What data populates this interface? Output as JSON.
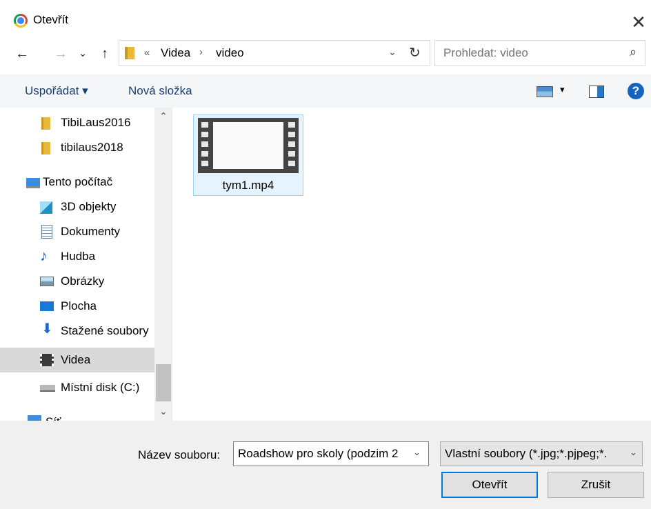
{
  "window": {
    "title": "Otevřít",
    "close_symbol": "✕"
  },
  "nav": {
    "back": "←",
    "forward": "→",
    "recent": "⌄",
    "up": "↑"
  },
  "address": {
    "separator": "«",
    "crumbs": [
      "Videa",
      "video"
    ],
    "arrow": "›",
    "dropdown": "⌄",
    "refresh": "↻"
  },
  "search": {
    "placeholder": "Prohledat: video",
    "icon": "⌕"
  },
  "toolbar": {
    "organize": "Uspořádat ▾",
    "new_folder": "Nová složka",
    "view_dropdown": "▾",
    "help": "?"
  },
  "sidebar": {
    "items": [
      {
        "label": "TibiLaus2016",
        "icon": "folder-icon"
      },
      {
        "label": "tibilaus2018",
        "icon": "folder-icon"
      },
      {
        "label": "Tento počítač",
        "icon": "computer-icon"
      },
      {
        "label": "3D objekty",
        "icon": "cube-icon"
      },
      {
        "label": "Dokumenty",
        "icon": "document-icon"
      },
      {
        "label": "Hudba",
        "icon": "music-icon"
      },
      {
        "label": "Obrázky",
        "icon": "picture-icon"
      },
      {
        "label": "Plocha",
        "icon": "desktop-icon"
      },
      {
        "label": "Stažené soubory",
        "icon": "download-icon"
      },
      {
        "label": "Videa",
        "icon": "video-icon",
        "selected": true
      },
      {
        "label": "Místní disk (C:)",
        "icon": "disk-icon"
      },
      {
        "label": "Síť",
        "icon": "network-icon"
      }
    ],
    "scroll_up": "⌃",
    "scroll_down": "⌄"
  },
  "files": [
    {
      "name": "tym1.mp4",
      "icon": "video-file-icon"
    }
  ],
  "footer": {
    "filename_label": "Název souboru:",
    "filename_value": "Roadshow pro skoly (podzim 2",
    "filename_dropdown": "⌄",
    "filetype_value": "Vlastní soubory (*.jpg;*.pjpeg;*.",
    "filetype_dropdown": "⌄",
    "open_label": "Otevřít",
    "cancel_label": "Zrušit"
  },
  "colors": {
    "accent": "#0078d7",
    "selection": "#d9d9d9",
    "folder": "#e8b93b",
    "link": "#1a3e6e"
  }
}
